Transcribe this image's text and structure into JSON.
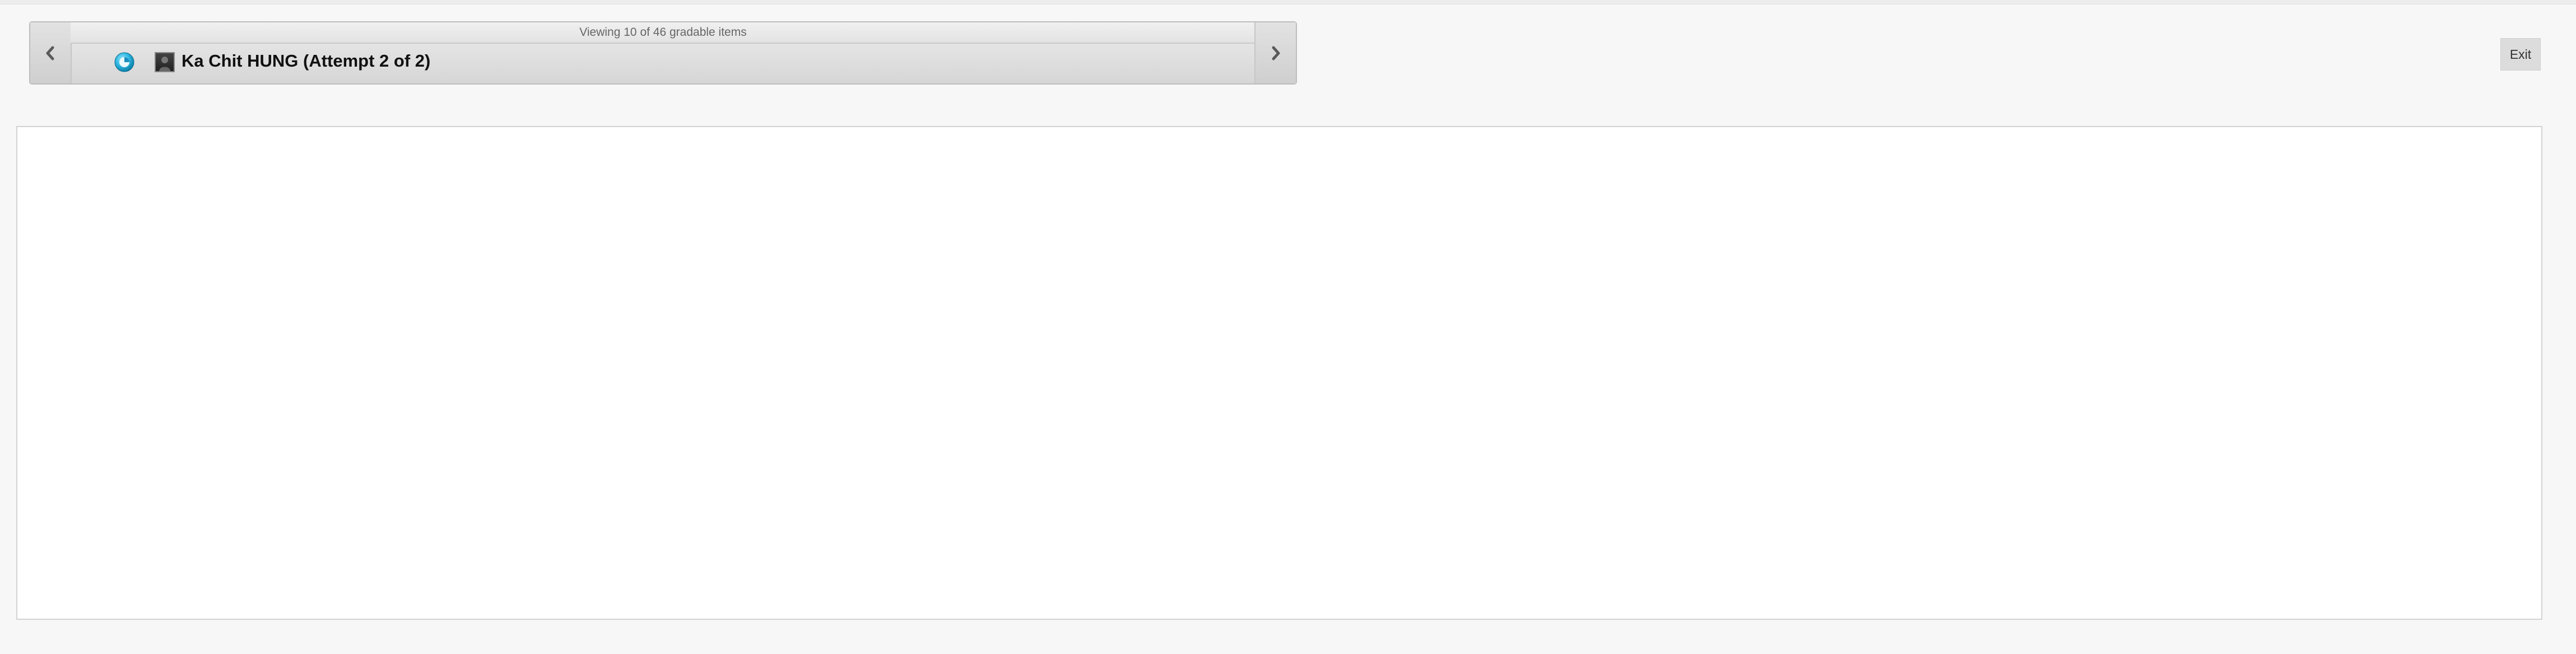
{
  "navigator": {
    "header_text": "Viewing 10 of 46 gradable items",
    "student_label": "Ka Chit HUNG (Attempt 2 of 2)",
    "prev_icon": "chevron-left-icon",
    "next_icon": "chevron-right-icon",
    "status_icon": "in-progress-status-icon"
  },
  "toolbar": {
    "exit_label": "Exit"
  },
  "colors": {
    "background": "#f7f7f7",
    "status_accent": "#2fb6e0",
    "panel": "#ffffff"
  }
}
